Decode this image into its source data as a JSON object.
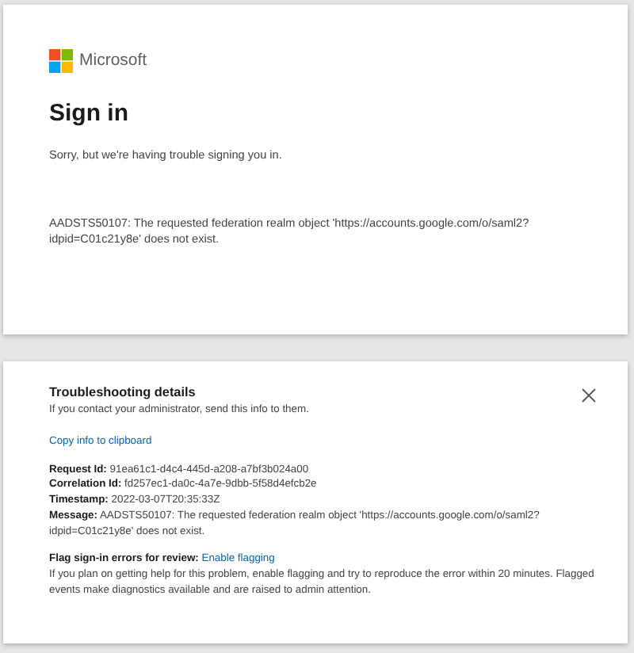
{
  "brand": "Microsoft",
  "title": "Sign in",
  "message": "Sorry, but we're having trouble signing you in.",
  "error": "AADSTS50107: The requested federation realm object 'https://accounts.google.com/o/saml2?idpid=C01c21y8e' does not exist.",
  "details": {
    "title": "Troubleshooting details",
    "intro": "If you contact your administrator, send this info to them.",
    "copy_link": "Copy info to clipboard",
    "fields": [
      {
        "label": "Request Id:",
        "value": "91ea61c1-d4c4-445d-a208-a7bf3b024a00"
      },
      {
        "label": "Correlation Id:",
        "value": "fd257ec1-da0c-4a7e-9dbb-5f58d4efcb2e"
      },
      {
        "label": "Timestamp:",
        "value": "2022-03-07T20:35:33Z"
      },
      {
        "label": "Message:",
        "value": "AADSTS50107: The requested federation realm object 'https://accounts.google.com/o/saml2?idpid=C01c21y8e' does not exist."
      }
    ],
    "flag": {
      "label": "Flag sign-in errors for review:",
      "link": "Enable flagging",
      "description": "If you plan on getting help for this problem, enable flagging and try to reproduce the error within 20 minutes. Flagged events make diagnostics available and are raised to admin attention."
    }
  }
}
